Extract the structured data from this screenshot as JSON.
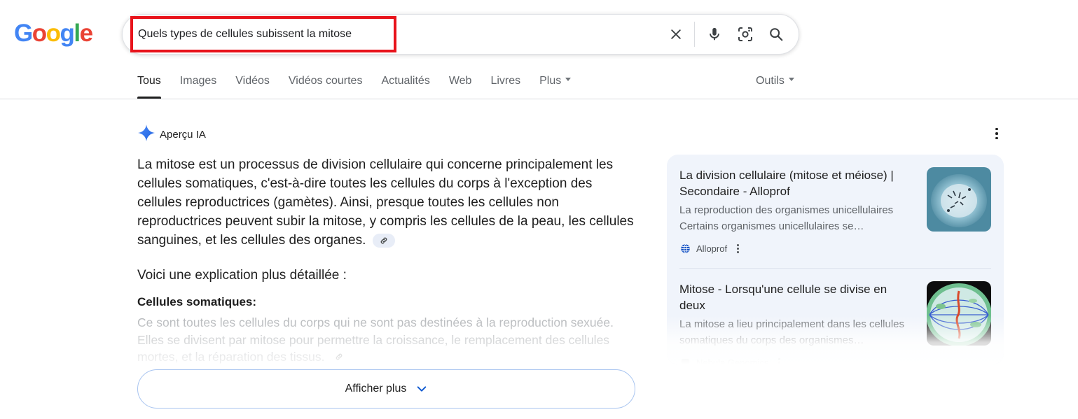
{
  "logo": {
    "text": "Google",
    "letters": [
      {
        "char": "G",
        "color": "#4285F4"
      },
      {
        "char": "o",
        "color": "#EA4335"
      },
      {
        "char": "o",
        "color": "#FBBC05"
      },
      {
        "char": "g",
        "color": "#4285F4"
      },
      {
        "char": "l",
        "color": "#34A853"
      },
      {
        "char": "e",
        "color": "#EA4335"
      }
    ]
  },
  "search": {
    "query": "Quels types de cellules subissent la mitose",
    "icons": [
      "clear-icon",
      "microphone-icon",
      "lens-icon",
      "search-icon"
    ],
    "highlight_color": "#e8131b"
  },
  "tabs": [
    {
      "label": "Tous",
      "active": true
    },
    {
      "label": "Images"
    },
    {
      "label": "Vidéos"
    },
    {
      "label": "Vidéos courtes"
    },
    {
      "label": "Actualités"
    },
    {
      "label": "Web"
    },
    {
      "label": "Livres"
    },
    {
      "label": "Plus",
      "dropdown": true
    }
  ],
  "tools_label": "Outils",
  "ai_overview": {
    "title": "Aperçu IA",
    "answer": "La mitose est un processus de division cellulaire qui concerne principalement les cellules somatiques, c'est-à-dire toutes les cellules du corps à l'exception des cellules reproductrices (gamètes). Ainsi, presque toutes les cellules non reproductrices peuvent subir la mitose, y compris les cellules de la peau, les cellules sanguines, et les cellules des organes.",
    "detail_intro": "Voici une explication plus détaillée :",
    "subhead": "Cellules somatiques:",
    "subtext": "Ce sont toutes les cellules du corps qui ne sont pas destinées à la reproduction sexuée. Elles se divisent par mitose pour permettre la croissance, le remplacement des cellules mortes, et la réparation des tissus.",
    "show_more_label": "Afficher plus"
  },
  "sources": [
    {
      "title": "La division cellulaire (mitose et méiose) | Secondaire - Alloprof",
      "snippet": "La reproduction des organismes unicellulaires Certains organismes unicellulaires se…",
      "site": "Alloprof"
    },
    {
      "title": "Mitose - Lorsqu'une cellule se divise en deux",
      "snippet": "La mitose a lieu principalement dans les cellules somatiques du corps des organismes…",
      "site": "Nebula Genomics"
    }
  ],
  "colors": {
    "accent": "#0b57d0",
    "sources_bg": "#f0f4fb",
    "show_more_border": "#a8c4f0"
  }
}
